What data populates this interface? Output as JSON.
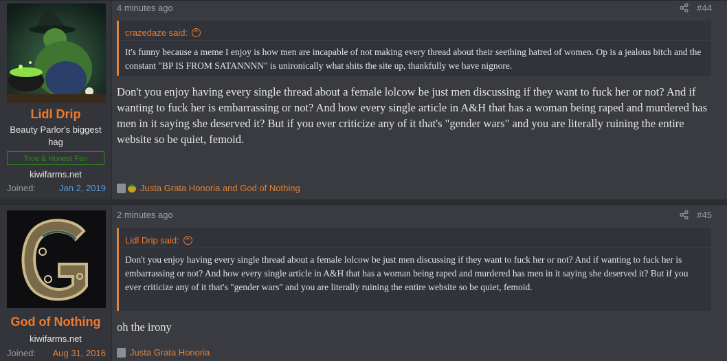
{
  "posts": [
    {
      "id_label": "#44",
      "time": "4 minutes ago",
      "user": {
        "name": "Lidl Drip",
        "title": "Beauty Parlor's biggest hag",
        "banner": "True & Honest Fan",
        "site": "kiwifarms.net",
        "joined_label": "Joined:",
        "joined_date": "Jan 2, 2019"
      },
      "quote": {
        "author": "crazedaze said:",
        "text": "It's funny because a meme I enjoy is how men are incapable of not making every thread about their seething hatred of women. Op is a jealous bitch and the constant \"BP IS FROM SATANNNN\" is unironically what shits the site up, thankfully we have nignore."
      },
      "message": "Don't you enjoy having every single thread about a female lolcow be just men discussing if they want to fuck her or not? And if wanting to fuck her is embarrassing or not? And how every single article in A&H that has a woman being raped and murdered has men in it saying she deserved it? But if you ever criticize any of it that's \"gender wars\" and you are literally ruining the entire website so be quiet, femoid.",
      "reactions": "Justa Grata Honoria and God of Nothing"
    },
    {
      "id_label": "#45",
      "time": "2 minutes ago",
      "user": {
        "name": "God of Nothing",
        "site": "kiwifarms.net",
        "joined_label": "Joined:",
        "joined_date": "Aug 31, 2016"
      },
      "quote": {
        "author": "Lidl Drip said:",
        "text": "Don't you enjoy having every single thread about a female lolcow be just men discussing if they want to fuck her or not? And if wanting to fuck her is embarrassing or not? And how every single article in A&H that has a woman being raped and murdered has men in it saying she deserved it? But if you ever criticize any of it that's \"gender wars\" and you are literally ruining the entire website so be quiet, femoid."
      },
      "message": "oh the irony",
      "reactions": "Justa Grata Honoria"
    }
  ],
  "colors": {
    "accent": "#f07a2a",
    "background": "#393b40",
    "banner_green": "#2c8a1c",
    "joined_blue": "#5b9bd5"
  },
  "icons": {
    "share": "share-icon",
    "quote_jump": "arrow-up-circle-icon",
    "reaction_1": "rating-icon",
    "reaction_2": "medal-icon"
  }
}
